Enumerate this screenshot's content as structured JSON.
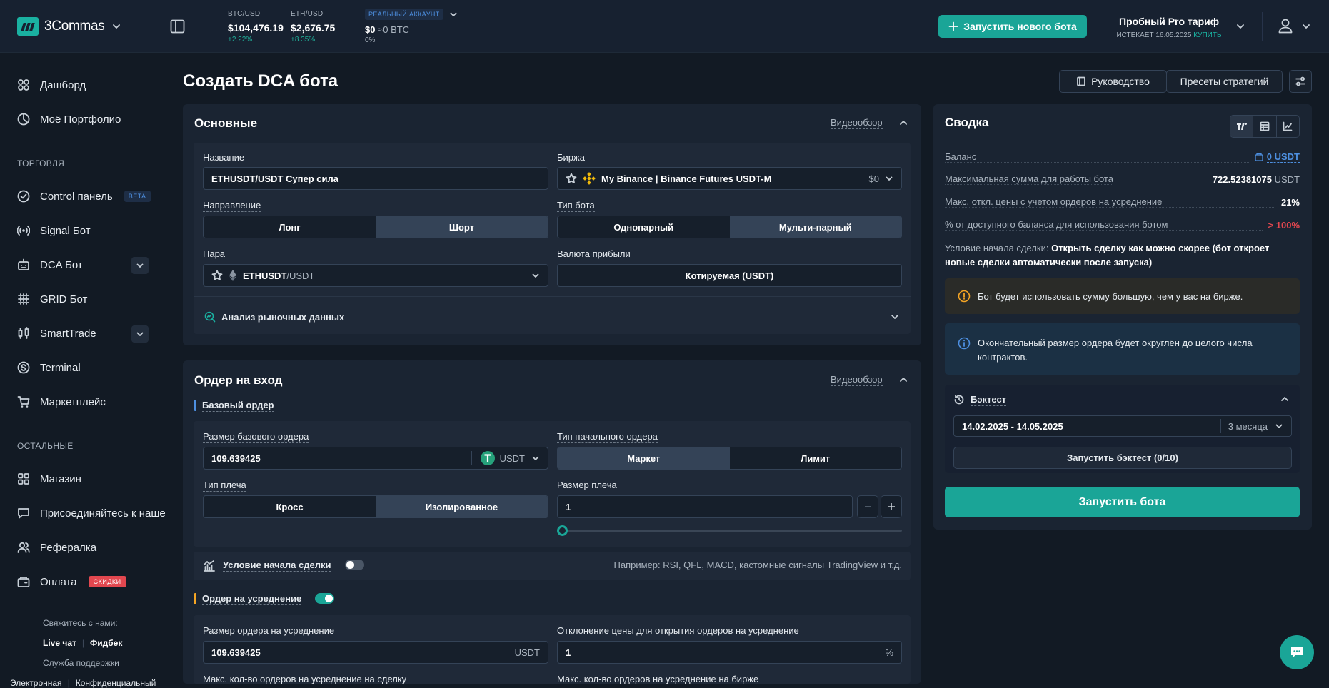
{
  "header": {
    "logo_text": "3Commas",
    "tickers": [
      {
        "label": "BTC/USD",
        "value": "$104,476.19",
        "change": "+2.22%"
      },
      {
        "label": "ETH/USD",
        "value": "$2,676.75",
        "change": "+8.35%"
      }
    ],
    "account": {
      "badge": "РЕАЛЬНЫЙ АККАУНТ",
      "balance": "$0",
      "balance_btc": "≈0 BTC",
      "percent": "0%"
    },
    "start_bot_button": "Запустить нового бота",
    "plan": {
      "title": "Пробный Pro тариф",
      "expires": "ИСТЕКАЕТ 16.05.2025",
      "buy": "КУПИТЬ"
    }
  },
  "sidebar": {
    "items": [
      {
        "label": "Дашборд"
      },
      {
        "label": "Моё Портфолио"
      }
    ],
    "trading_heading": "ТОРГОВЛЯ",
    "trading_items": [
      {
        "label": "Control панель",
        "badge": "BETA"
      },
      {
        "label": "Signal Бот"
      },
      {
        "label": "DCA Бот"
      },
      {
        "label": "GRID Бот"
      },
      {
        "label": "SmartTrade"
      },
      {
        "label": "Terminal"
      },
      {
        "label": "Маркетплейс"
      }
    ],
    "other_heading": "ОСТАЛЬНЫЕ",
    "other_items": [
      {
        "label": "Магазин"
      },
      {
        "label": "Присоединяйтесь к наше"
      },
      {
        "label": "Рефералка"
      },
      {
        "label": "Оплата",
        "badge": "СКИДКИ"
      }
    ],
    "contact": {
      "title": "Свяжитесь с нами:",
      "live_chat": "Live чат",
      "feedback": "Фидбек",
      "support": "Служба поддержки",
      "email": "Электронная",
      "privacy": "Конфиденциальный"
    }
  },
  "page": {
    "title": "Создать DCA бота",
    "guide_button": "Руководство",
    "presets_button": "Пресеты стратегий"
  },
  "main_section": {
    "title": "Основные",
    "video": "Видеообзор",
    "name_label": "Название",
    "name_value": "ETHUSDT/USDT Супер сила",
    "exchange_label": "Биржа",
    "exchange_value": "My Binance | Binance Futures USDT-M",
    "exchange_balance": "$0",
    "direction_label": "Направление",
    "direction_options": [
      "Лонг",
      "Шорт"
    ],
    "bot_type_label": "Тип бота",
    "bot_type_options": [
      "Однопарный",
      "Мульти-парный"
    ],
    "pair_label": "Пара",
    "pair_base": "ETHUSDT",
    "pair_quote": "/USDT",
    "profit_currency_label": "Валюта прибыли",
    "profit_currency_value": "Котируемая (USDT)",
    "market_analysis": "Анализ рыночных данных"
  },
  "entry_section": {
    "title": "Ордер на вход",
    "video": "Видеообзор",
    "base_order_heading": "Базовый ордер",
    "base_size_label": "Размер базового ордера",
    "base_size_value": "109.639425",
    "base_size_currency": "USDT",
    "start_order_type_label": "Тип начального ордера",
    "start_order_type_options": [
      "Маркет",
      "Лимит"
    ],
    "leverage_type_label": "Тип плеча",
    "leverage_type_options": [
      "Кросс",
      "Изолированное"
    ],
    "leverage_size_label": "Размер плеча",
    "leverage_size_value": "1",
    "deal_start_label": "Условие начала сделки",
    "deal_start_hint": "Например: RSI, QFL, MACD, кастомные сигналы TradingView и т.д.",
    "averaging_heading": "Ордер на усреднение",
    "averaging_size_label": "Размер ордера на усреднение",
    "averaging_size_value": "109.639425",
    "averaging_size_currency": "USDT",
    "deviation_label": "Отклонение цены для открытия ордеров на усреднение",
    "deviation_value": "1",
    "deviation_unit": "%",
    "max_per_deal_label": "Макс. кол-во ордеров на усреднение на сделку",
    "max_on_exchange_label": "Макс. кол-во ордеров на усреднение на бирже"
  },
  "summary": {
    "title": "Сводка",
    "rows": [
      {
        "key": "Баланс",
        "value": "0 USDT"
      },
      {
        "key": "Максимальная сумма для работы бота",
        "value": "722.52381075",
        "unit": "USDT"
      },
      {
        "key": "Макс. откл. цены с учетом ордеров на усреднение",
        "value": "21%"
      },
      {
        "key": "% от доступного баланса для использования ботом",
        "value": "> 100%"
      }
    ],
    "condition_label": "Условие начала сделки:",
    "condition_value": "Открыть сделку как можно скорее (бот откроет новые сделки автоматически после запуска)",
    "warning_text": "Бот будет использовать сумму большую, чем у вас на бирже.",
    "info_text": "Окончательный размер ордера будет округлён до целого числа контрактов.",
    "backtest_title": "Бэктест",
    "backtest_range": "14.02.2025 - 14.05.2025",
    "backtest_period": "3 месяца",
    "backtest_button": "Запустить бэктест (0/10)",
    "launch_button": "Запустить бота"
  },
  "colors": {
    "accent": "#1aa597",
    "positive": "#21b59d",
    "negative": "#e2474f",
    "background": "#121a24",
    "card": "#1a2432"
  },
  "icons": [
    "logo-icon",
    "chevron-down-icon",
    "sidebar-toggle-icon",
    "plus-icon",
    "user-icon",
    "dashboard-icon",
    "portfolio-icon",
    "control-icon",
    "signal-icon",
    "dca-icon",
    "grid-icon",
    "smarttrade-icon",
    "terminal-icon",
    "marketplace-icon",
    "shop-icon",
    "chat-icon",
    "referral-icon",
    "payment-icon",
    "book-icon",
    "settings-icon",
    "star-icon",
    "binance-icon",
    "tether-icon",
    "warning-icon",
    "info-icon",
    "history-icon",
    "support-chat-icon"
  ]
}
